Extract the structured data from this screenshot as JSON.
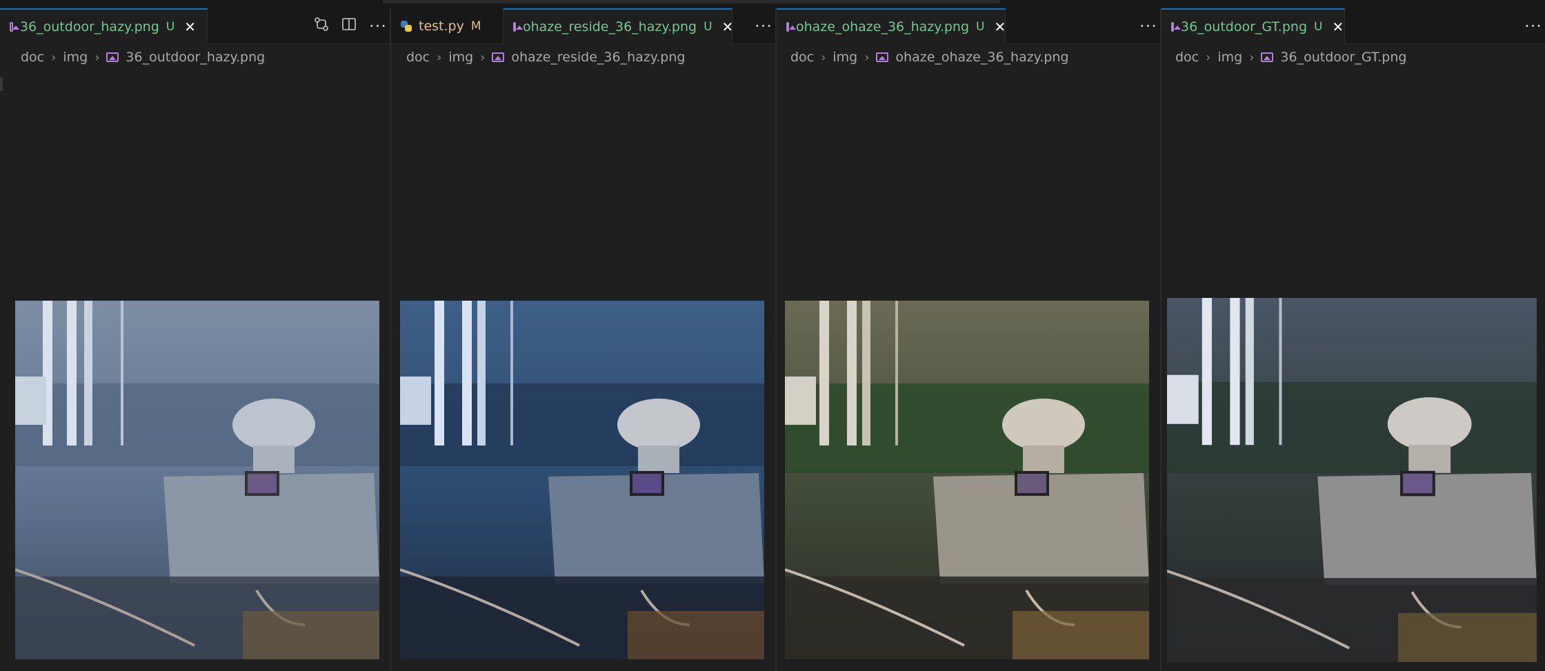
{
  "groups": [
    {
      "tabs": [
        {
          "label": "36_outdoor_hazy.png",
          "status": "U",
          "icon": "image-icon",
          "active": true
        }
      ],
      "breadcrumb": [
        "doc",
        "img",
        "36_outdoor_hazy.png"
      ],
      "actions": [
        "compare-changes-icon",
        "split-editor-icon",
        "more-actions-icon"
      ]
    },
    {
      "tabs": [
        {
          "label": "test.py",
          "status": "M",
          "icon": "python-icon",
          "active": false
        },
        {
          "label": "ohaze_reside_36_hazy.png",
          "status": "U",
          "icon": "image-icon",
          "active": true
        }
      ],
      "breadcrumb": [
        "doc",
        "img",
        "ohaze_reside_36_hazy.png"
      ],
      "actions": [
        "more-actions-icon"
      ]
    },
    {
      "tabs": [
        {
          "label": "ohaze_ohaze_36_hazy.png",
          "status": "U",
          "icon": "image-icon",
          "active": true
        }
      ],
      "breadcrumb": [
        "doc",
        "img",
        "ohaze_ohaze_36_hazy.png"
      ],
      "actions": [
        "more-actions-icon"
      ]
    },
    {
      "tabs": [
        {
          "label": "36_outdoor_GT.png",
          "status": "U",
          "icon": "image-icon",
          "active": true
        }
      ],
      "breadcrumb": [
        "doc",
        "img",
        "36_outdoor_GT.png"
      ],
      "actions": [
        "more-actions-icon"
      ]
    }
  ],
  "glyphs": {
    "close": "✕",
    "more": "···",
    "chevron": "›"
  },
  "colors": {
    "untracked": "#73c991",
    "modified": "#e2c08d",
    "accent": "#0078d4",
    "image_icon": "#b180d7"
  }
}
